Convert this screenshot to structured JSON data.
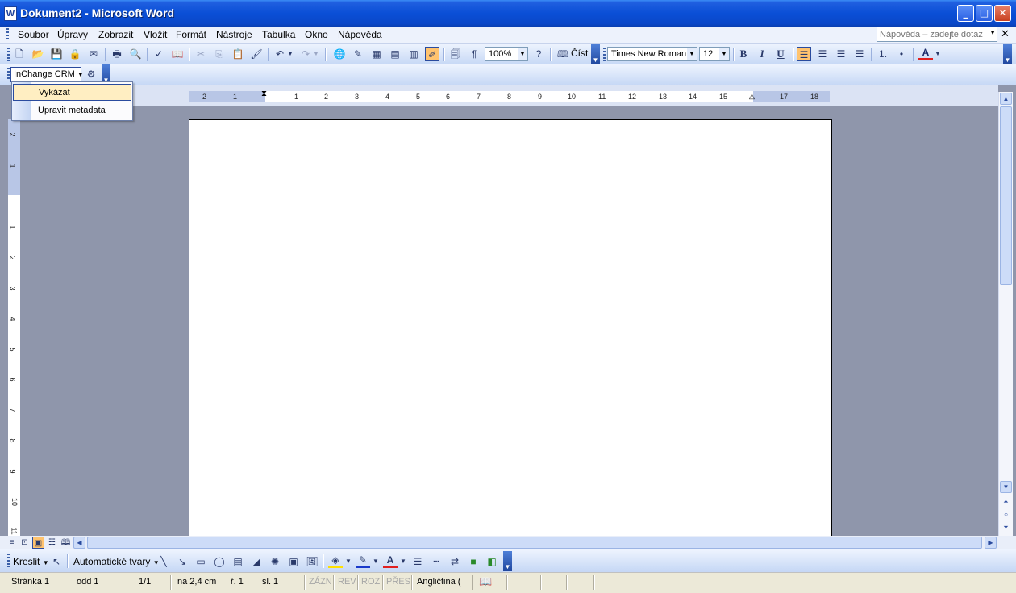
{
  "window": {
    "title": "Dokument2 - Microsoft Word",
    "app_icon": "W"
  },
  "menu": {
    "items": [
      "Soubor",
      "Úpravy",
      "Zobrazit",
      "Vložit",
      "Formát",
      "Nástroje",
      "Tabulka",
      "Okno",
      "Nápověda"
    ],
    "help_placeholder": "Nápověda – zadejte dotaz"
  },
  "standard_toolbar": {
    "zoom": "100%",
    "read_label": "Číst"
  },
  "formatting_toolbar": {
    "font": "Times New Roman",
    "size": "12",
    "bold": "B",
    "italic": "I",
    "underline": "U"
  },
  "crm_toolbar": {
    "label": "InChange CRM"
  },
  "crm_menu": {
    "items": [
      "Vykázat",
      "Upravit metadata"
    ],
    "highlighted": "Vykázat"
  },
  "ruler": {
    "horizontal_ticks": [
      "2",
      "1",
      "1",
      "2",
      "3",
      "4",
      "5",
      "6",
      "7",
      "8",
      "9",
      "10",
      "11",
      "12",
      "13",
      "14",
      "15",
      "17",
      "18"
    ],
    "vertical_ticks": [
      "2",
      "1",
      "1",
      "2",
      "3",
      "4",
      "5",
      "6",
      "7",
      "8",
      "9",
      "10",
      "11"
    ]
  },
  "drawing_toolbar": {
    "draw_label": "Kreslit",
    "autoshapes_label": "Automatické tvary"
  },
  "status": {
    "page": "Stránka 1",
    "section": "odd 1",
    "pages": "1/1",
    "at": "na 2,4 cm",
    "line": "ř. 1",
    "column": "sl. 1",
    "rec": "ZÁZN",
    "trk": "REV",
    "ext": "ROZ",
    "ovr": "PŘES",
    "language": "Angličtina ("
  }
}
